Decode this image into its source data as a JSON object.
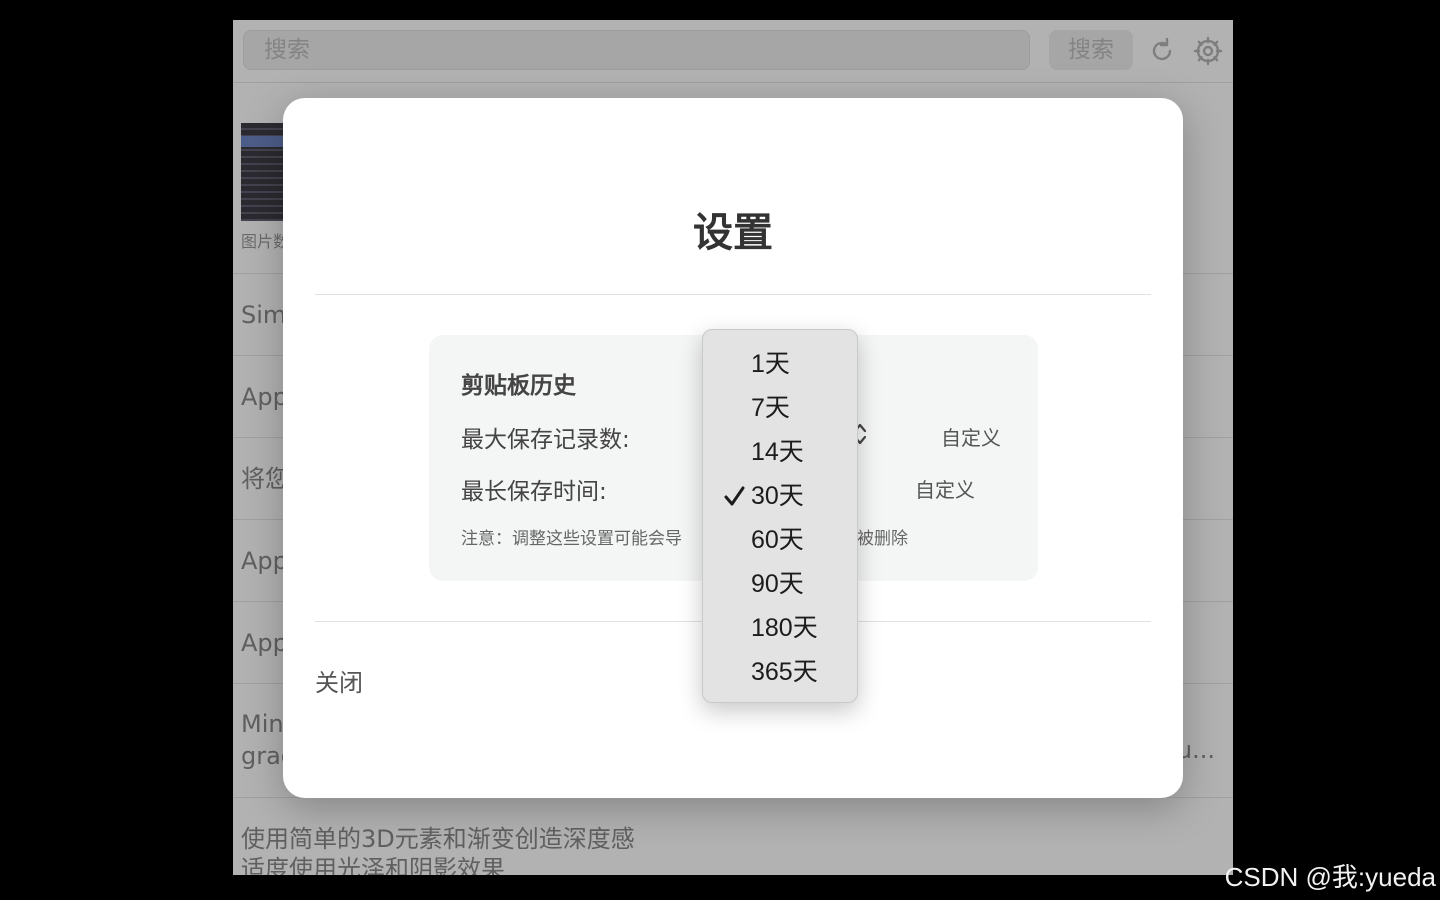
{
  "toolbar": {
    "search_placeholder": "搜索",
    "search_button": "搜索",
    "refresh_icon": "refresh-icon",
    "settings_icon": "gear-icon"
  },
  "list": {
    "thumb_label": "图片数",
    "rows": [
      {
        "text": "Sim"
      },
      {
        "text": "App"
      },
      {
        "text": "将您"
      },
      {
        "text": "App"
      },
      {
        "text": "App"
      },
      {
        "line1": "Min",
        "line2": "grad",
        "right": "u..."
      },
      {
        "line1": "使用简单的3D元素和渐变创造深度感",
        "line2": "适度使用光泽和阴影效果"
      }
    ]
  },
  "modal": {
    "title": "设置",
    "section_title": "剪贴板历史",
    "max_records_label": "最大保存记录数:",
    "max_time_label": "最长保存时间:",
    "custom_1": "自定义",
    "custom_2": "自定义",
    "note": "注意：调整这些设置可能会导",
    "note_tail": "被删除",
    "close_label": "关闭"
  },
  "dropdown": {
    "selected": "30天",
    "options": [
      "1天",
      "7天",
      "14天",
      "30天",
      "60天",
      "90天",
      "180天",
      "365天"
    ]
  },
  "watermark": "CSDN @我:yueda"
}
